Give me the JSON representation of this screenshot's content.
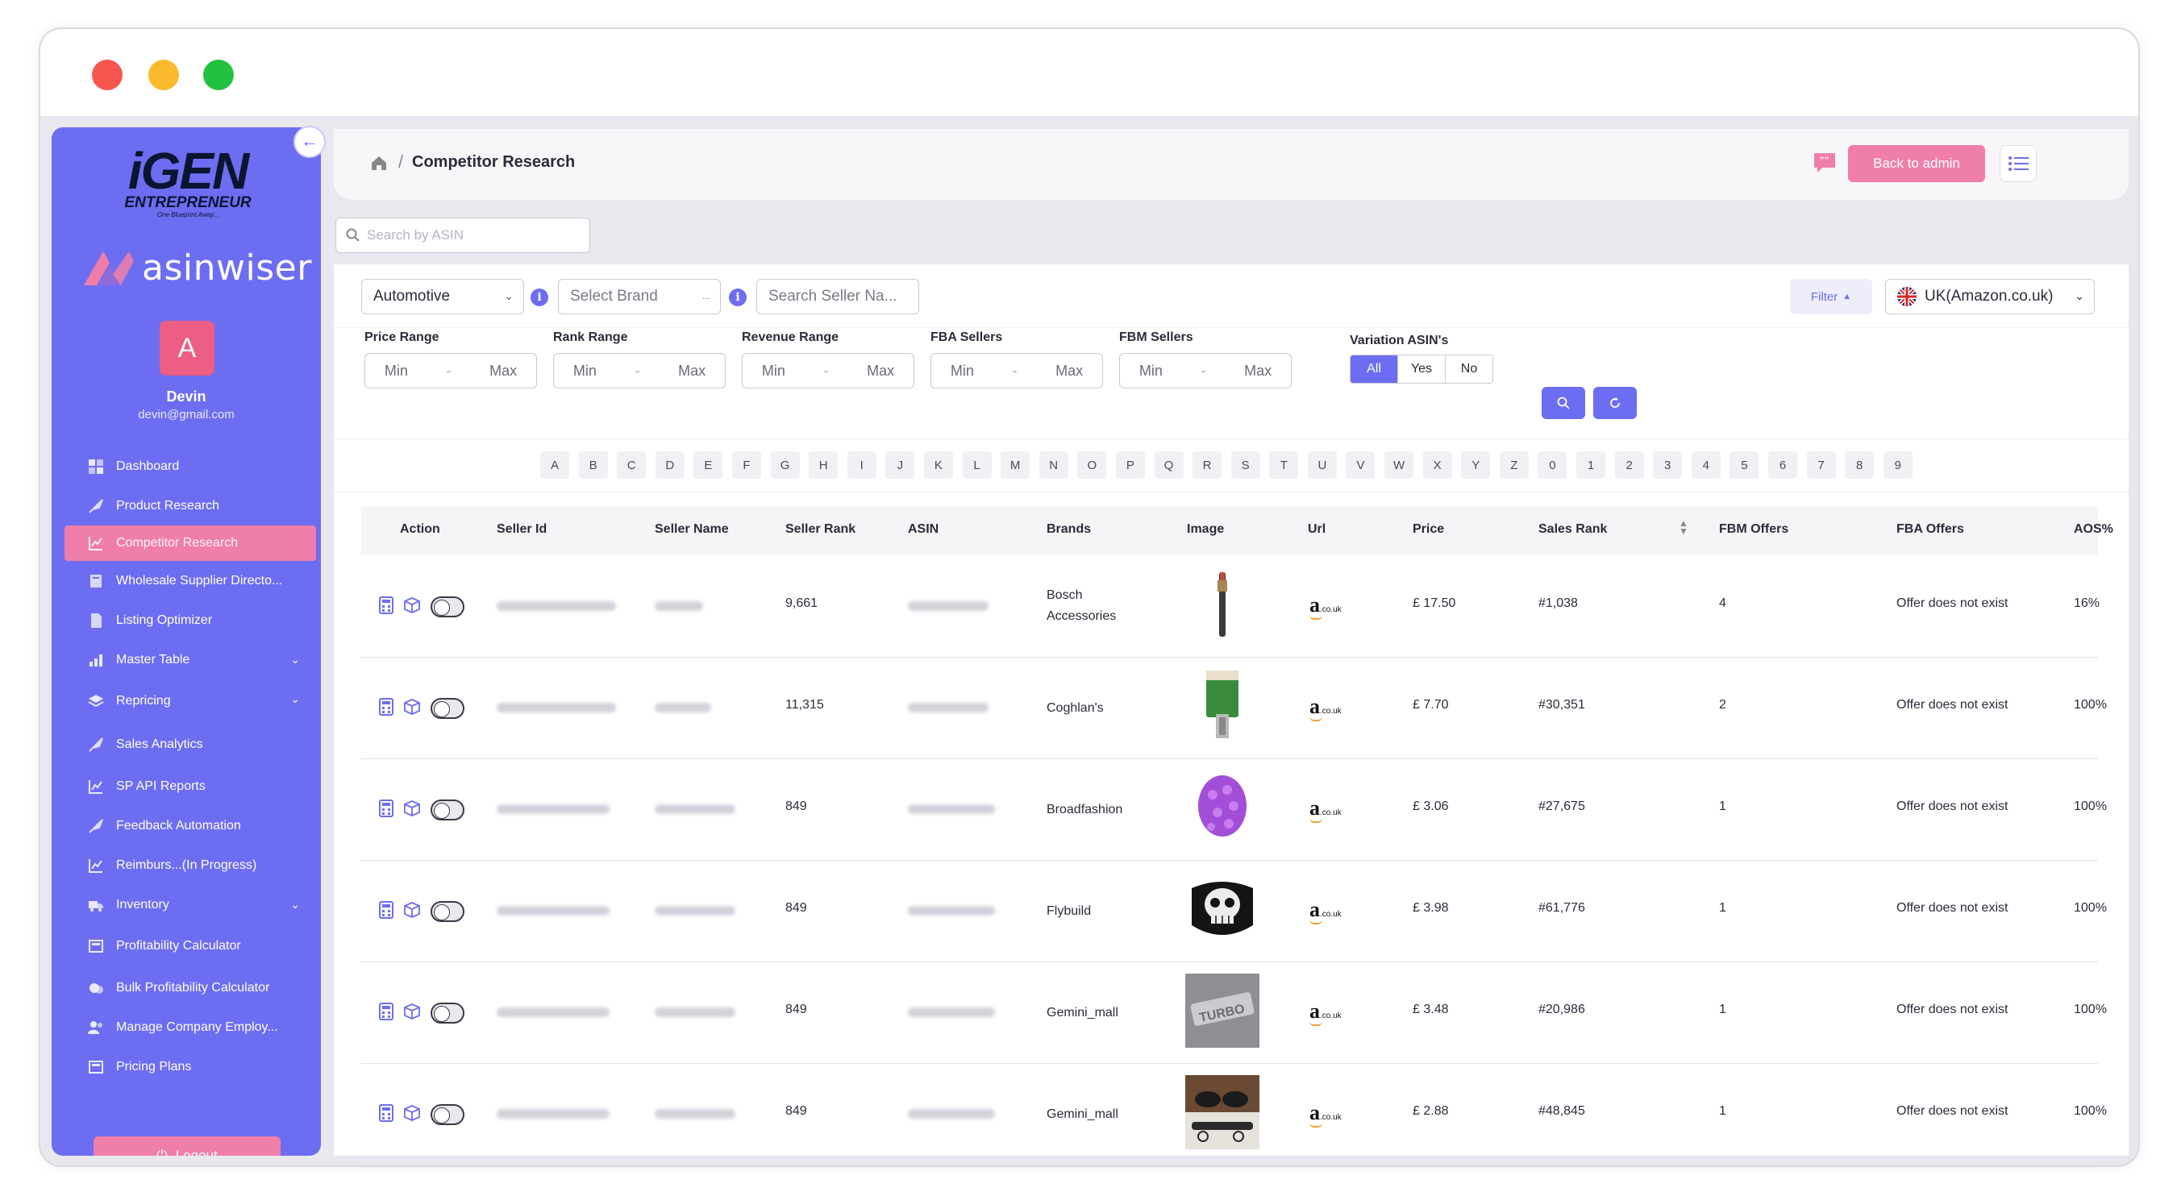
{
  "app": {
    "brand_igen": "iGEN",
    "brand_igen_sub": "ENTREPRENEUR",
    "brand_igen_tag": "One Blueprint Away...",
    "brand_asinwiser": "asinwiser"
  },
  "user": {
    "initial": "A",
    "name": "Devin",
    "email": "devin@gmail.com"
  },
  "sidebar": {
    "items": [
      {
        "label": "Dashboard",
        "icon": "dashboard-icon"
      },
      {
        "label": "Product Research",
        "icon": "rocket-icon"
      },
      {
        "label": "Competitor Research",
        "icon": "chart-icon",
        "active": true
      },
      {
        "label": "Wholesale Supplier Directo...",
        "icon": "book-icon"
      },
      {
        "label": "Listing Optimizer",
        "icon": "document-icon"
      },
      {
        "label": "Master Table",
        "icon": "bar-chart-icon",
        "expandable": true
      },
      {
        "label": "Repricing",
        "icon": "layers-icon",
        "expandable": true
      },
      {
        "label": "Sales Analytics",
        "icon": "rocket-icon"
      },
      {
        "label": "SP API Reports",
        "icon": "chart-icon"
      },
      {
        "label": "Feedback Automation",
        "icon": "rocket-icon"
      },
      {
        "label": "Reimburs...(In Progress)",
        "icon": "chart-icon"
      },
      {
        "label": "Inventory",
        "icon": "truck-icon",
        "expandable": true
      },
      {
        "label": "Profitability Calculator",
        "icon": "calculator-icon"
      },
      {
        "label": "Bulk Profitability Calculator",
        "icon": "coins-icon"
      },
      {
        "label": "Manage Company Employ...",
        "icon": "users-icon"
      },
      {
        "label": "Pricing Plans",
        "icon": "tag-icon"
      }
    ],
    "logout_label": "Logout"
  },
  "header": {
    "breadcrumb_sep": "/",
    "title": "Competitor Research",
    "back_label": "Back to admin"
  },
  "search": {
    "placeholder": "Search by ASIN"
  },
  "filters": {
    "category": "Automotive",
    "brand_placeholder": "Select Brand",
    "seller_placeholder": "Search Seller Na...",
    "filter_label": "Filter",
    "marketplace": "UK(Amazon.co.uk)",
    "ranges": [
      {
        "label": "Price Range",
        "min": "Min",
        "max": "Max"
      },
      {
        "label": "Rank Range",
        "min": "Min",
        "max": "Max"
      },
      {
        "label": "Revenue Range",
        "min": "Min",
        "max": "Max"
      },
      {
        "label": "FBA Sellers",
        "min": "Min",
        "max": "Max"
      },
      {
        "label": "FBM Sellers",
        "min": "Min",
        "max": "Max"
      }
    ],
    "variation": {
      "label": "Variation ASIN's",
      "options": [
        "All",
        "Yes",
        "No"
      ],
      "selected": "All"
    },
    "alphabet": [
      "A",
      "B",
      "C",
      "D",
      "E",
      "F",
      "G",
      "H",
      "I",
      "J",
      "K",
      "L",
      "M",
      "N",
      "O",
      "P",
      "Q",
      "R",
      "S",
      "T",
      "U",
      "V",
      "W",
      "X",
      "Y",
      "Z",
      "0",
      "1",
      "2",
      "3",
      "4",
      "5",
      "6",
      "7",
      "8",
      "9"
    ]
  },
  "table": {
    "columns": [
      "Action",
      "Seller Id",
      "Seller Name",
      "Seller Rank",
      "ASIN",
      "Brands",
      "Image",
      "Url",
      "Price",
      "Sales Rank",
      "FBM Offers",
      "FBA Offers",
      "AOS%"
    ],
    "url_suffix": ".co.uk",
    "rows": [
      {
        "seller_rank": "9,661",
        "brand": "Bosch Accessories",
        "price": "£ 17.50",
        "sales_rank": "#1,038",
        "fbm": "4",
        "fba": "Offer does not exist",
        "aos": "16%",
        "image": "wiper-blade"
      },
      {
        "seller_rank": "11,315",
        "brand": "Coghlan's",
        "price": "£ 7.70",
        "sales_rank": "#30,351",
        "fbm": "2",
        "fba": "Offer does not exist",
        "aos": "100%",
        "image": "packaged-tool"
      },
      {
        "seller_rank": "849",
        "brand": "Broadfashion",
        "price": "£ 3.06",
        "sales_rank": "#27,675",
        "fbm": "1",
        "fba": "Offer does not exist",
        "aos": "100%",
        "image": "purple-mitt"
      },
      {
        "seller_rank": "849",
        "brand": "Flybuild",
        "price": "£ 3.98",
        "sales_rank": "#61,776",
        "fbm": "1",
        "fba": "Offer does not exist",
        "aos": "100%",
        "image": "skull-mask"
      },
      {
        "seller_rank": "849",
        "brand": "Gemini_mall",
        "price": "£ 3.48",
        "sales_rank": "#20,986",
        "fbm": "1",
        "fba": "Offer does not exist",
        "aos": "100%",
        "image": "car-emblem"
      },
      {
        "seller_rank": "849",
        "brand": "Gemini_mall",
        "price": "£ 2.88",
        "sales_rank": "#48,845",
        "fbm": "1",
        "fba": "Offer does not exist",
        "aos": "100%",
        "image": "sunglasses-clip"
      }
    ]
  },
  "colors": {
    "accent": "#6d6df2",
    "pink": "#ef7fa8",
    "bg": "#e8e8ee"
  }
}
